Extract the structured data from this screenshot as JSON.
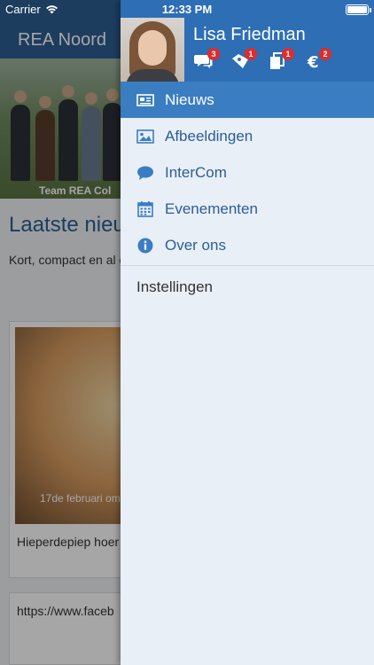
{
  "status_bar": {
    "carrier": "Carrier",
    "time": "12:33 PM"
  },
  "background": {
    "nav_title": "REA Noord",
    "hero_caption": "Team REA Col",
    "heading": "Laatste nieu",
    "intro": "Kort, compact en al en acties. Dit nieuws Facebook-pagina.",
    "card": {
      "date": "17de februari om",
      "text": "Hieperdepiep hoer College :-)"
    },
    "card2_text": "https://www.faceb"
  },
  "drawer": {
    "user_name": "Lisa Friedman",
    "header_icons": [
      {
        "icon": "chat-icon",
        "badge": "3"
      },
      {
        "icon": "deals-icon",
        "badge": "1"
      },
      {
        "icon": "documents-icon",
        "badge": "1"
      },
      {
        "icon": "euro-icon",
        "badge": "2"
      }
    ],
    "menu": [
      {
        "label": "Nieuws",
        "icon": "news-icon",
        "active": true
      },
      {
        "label": "Afbeeldingen",
        "icon": "images-icon",
        "active": false
      },
      {
        "label": "InterCom",
        "icon": "chat-bubble-icon",
        "active": false
      },
      {
        "label": "Evenementen",
        "icon": "calendar-icon",
        "active": false
      },
      {
        "label": "Over ons",
        "icon": "info-icon",
        "active": false
      }
    ],
    "settings_label": "Instellingen"
  },
  "colors": {
    "header_blue": "#2d6eb5",
    "active_blue": "#3b7dc1",
    "menu_text": "#2d5e93",
    "drawer_bg": "#e8eff7",
    "badge_red": "#e02c2c"
  }
}
